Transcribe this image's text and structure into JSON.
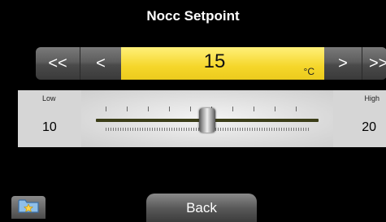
{
  "header": {
    "title": "Nocc Setpoint"
  },
  "stepper": {
    "fast_decrease_label": "<<",
    "decrease_label": "<",
    "increase_label": ">",
    "fast_increase_label": ">>",
    "value": "15",
    "unit": "°C"
  },
  "slider": {
    "low_label": "Low",
    "low_value": "10",
    "high_label": "High",
    "high_value": "20",
    "current": 15,
    "min": 10,
    "max": 20
  },
  "footer": {
    "folder_icon": "folder-star-icon",
    "back_label": "Back"
  },
  "colors": {
    "value_background": "#f5d62a",
    "track": "#3b3d18",
    "page_background": "#000000"
  }
}
